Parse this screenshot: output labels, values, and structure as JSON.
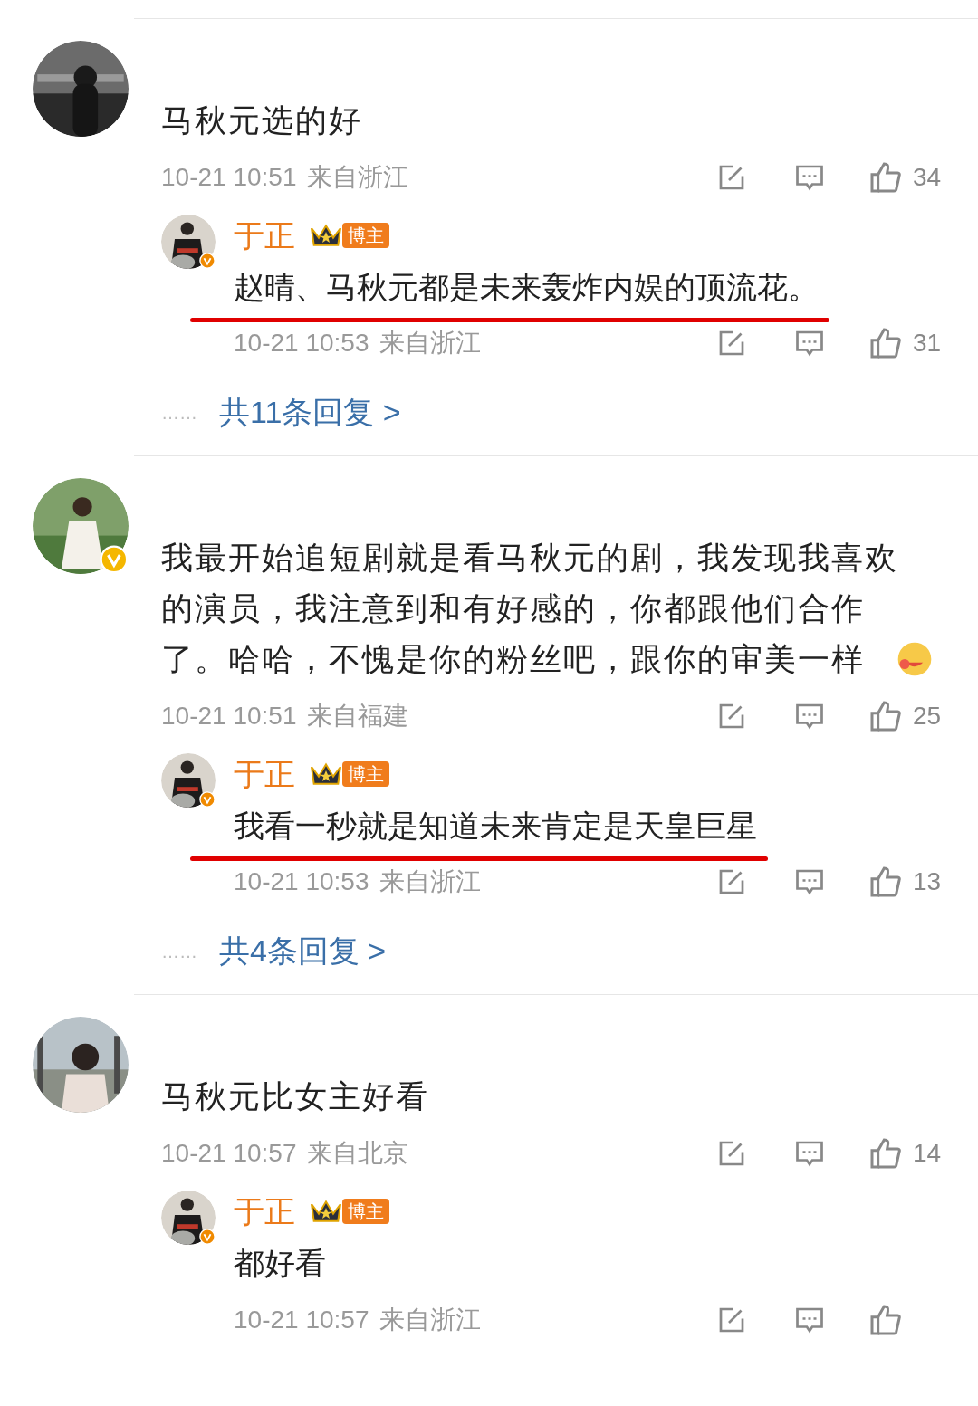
{
  "comments": [
    {
      "text": "马秋元选的好",
      "time": "10-21 10:51",
      "location": "来自浙江",
      "likes": "34",
      "reply": {
        "author": "于正",
        "badge": "博主",
        "verified": true,
        "text": "赵晴、马秋元都是未来轰炸内娱的顶流花。",
        "underlined": true,
        "time": "10-21 10:53",
        "location": "来自浙江",
        "likes": "31"
      },
      "more_replies": "共11条回复 >",
      "dots": "……"
    },
    {
      "verified": true,
      "text": "我最开始追短剧就是看马秋元的剧，我发现我喜欢的演员，我注意到和有好感的，你都跟他们合作了。哈哈，不愧是你的粉丝吧，跟你的审美一样",
      "emoji": true,
      "time": "10-21 10:51",
      "location": "来自福建",
      "likes": "25",
      "reply": {
        "author": "于正",
        "badge": "博主",
        "verified": true,
        "text": "我看一秒就是知道未来肯定是天皇巨星",
        "underlined": true,
        "time": "10-21 10:53",
        "location": "来自浙江",
        "likes": "13"
      },
      "more_replies": "共4条回复 >",
      "dots": "……"
    },
    {
      "text": "马秋元比女主好看",
      "time": "10-21 10:57",
      "location": "来自北京",
      "likes": "14",
      "reply": {
        "author": "于正",
        "badge": "博主",
        "verified": true,
        "text": "都好看",
        "time": "10-21 10:57",
        "location": "来自浙江"
      }
    }
  ]
}
